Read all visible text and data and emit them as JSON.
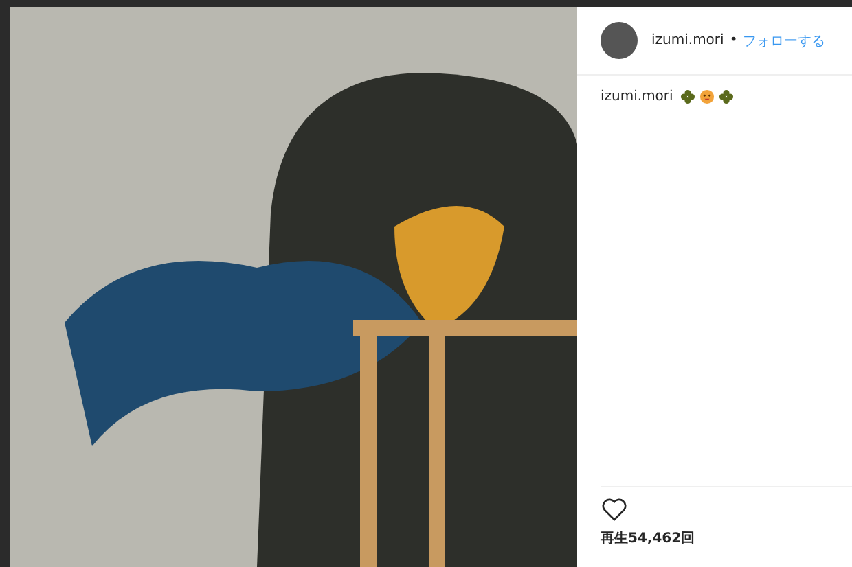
{
  "post": {
    "username": "izumi.mori",
    "separator": "•",
    "follow_label": "フォローする"
  },
  "caption": {
    "username": "izumi.mori"
  },
  "actions": {
    "liked": false
  },
  "views": "再生54,462回"
}
